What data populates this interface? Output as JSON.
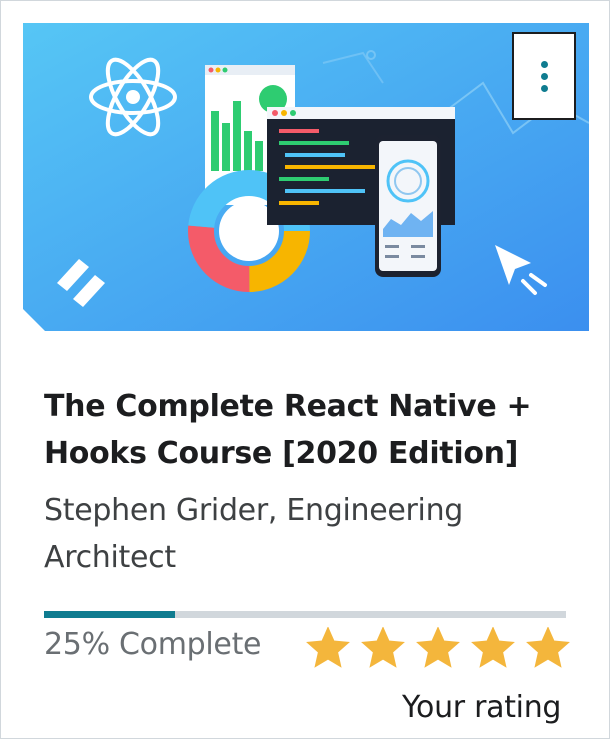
{
  "course": {
    "title": "The Complete React Native + Hooks Course [2020 Edition]",
    "instructor": "Stephen Grider, Engineering Architect",
    "progress_percent": 25,
    "progress_text": "25% Complete",
    "rating": 5,
    "rating_max": 5,
    "rating_label": "Your rating",
    "menu_icon": "vertical-ellipsis-icon"
  },
  "colors": {
    "accent": "#0f7c90",
    "star": "#f4b63c",
    "thumb_bg": "#4aa7f2"
  }
}
